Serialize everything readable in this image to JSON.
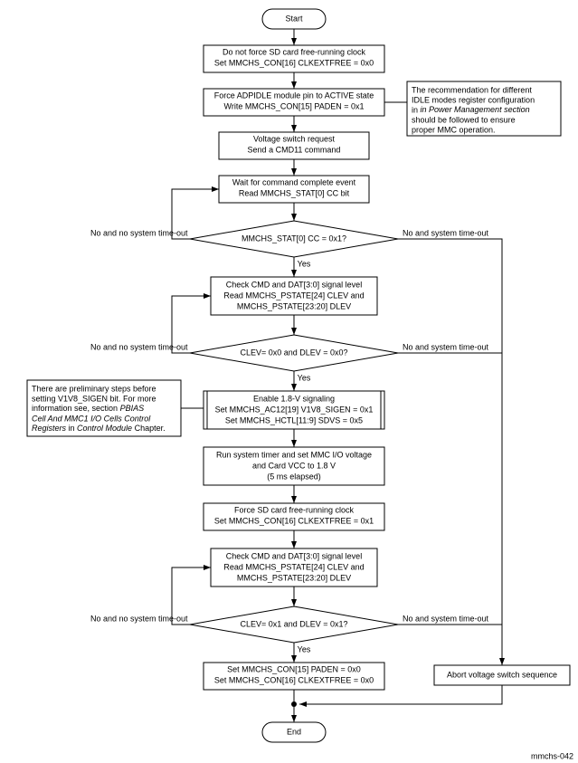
{
  "terminals": {
    "start": "Start",
    "end": "End"
  },
  "process": {
    "p1": {
      "l1": "Do not force SD card free-running clock",
      "l2": "Set MMCHS_CON[16] CLKEXTFREE = 0x0"
    },
    "p2": {
      "l1": "Force ADPIDLE module pin to ACTIVE state",
      "l2": "Write MMCHS_CON[15] PADEN = 0x1"
    },
    "p3": {
      "l1": "Voltage switch request",
      "l2": "Send a CMD11 command"
    },
    "p4": {
      "l1": "Wait for command complete event",
      "l2": "Read MMCHS_STAT[0] CC bit"
    },
    "p5": {
      "l1": "Check CMD and DAT[3:0] signal level",
      "l2": "Read MMCHS_PSTATE[24] CLEV and",
      "l3": "MMCHS_PSTATE[23:20] DLEV"
    },
    "p6": {
      "l1": "Enable 1.8-V signaling",
      "l2": "Set MMCHS_AC12[19] V1V8_SIGEN = 0x1",
      "l3": "Set MMCHS_HCTL[11:9] SDVS = 0x5"
    },
    "p7": {
      "l1": "Run system timer and set MMC I/O voltage",
      "l2": "and Card VCC to 1.8 V",
      "l3": "(5 ms elapsed)"
    },
    "p8": {
      "l1": "Force SD card free-running clock",
      "l2": "Set MMCHS_CON[16] CLKEXTFREE = 0x1"
    },
    "p9": {
      "l1": "Check CMD and DAT[3:0] signal level",
      "l2": "Read MMCHS_PSTATE[24] CLEV and",
      "l3": "MMCHS_PSTATE[23:20] DLEV"
    },
    "p10": {
      "l1": "Set MMCHS_CON[15] PADEN = 0x0",
      "l2": "Set MMCHS_CON[16] CLKEXTFREE = 0x0"
    },
    "abort": "Abort voltage switch sequence"
  },
  "decision": {
    "d1": "MMCHS_STAT[0] CC = 0x1?",
    "d2": "CLEV= 0x0 and DLEV = 0x0?",
    "d3": "CLEV= 0x1 and DLEV = 0x1?"
  },
  "labels": {
    "yes": "Yes",
    "noTimeout": "No and system time-out",
    "noNoTimeout": "No and no system time-out"
  },
  "notes": {
    "right": {
      "l1": "The recommendation for different",
      "l2": "IDLE modes register configuration",
      "l3i": "in Power Management section",
      "l4": "should be followed to ensure",
      "l5": "proper MMC operation."
    },
    "left": {
      "l1": "There are preliminary steps before",
      "l2": "setting V1V8_SIGEN bit. For more",
      "l3a": "information see, section ",
      "l3b": "PBIAS",
      "l4": "Cell And MMC1 I/O Cells Control",
      "l5a": "Registers",
      "l5b": " in ",
      "l5c": "Control Module",
      "l5d": " Chapter."
    }
  },
  "footer": "mmchs-042"
}
